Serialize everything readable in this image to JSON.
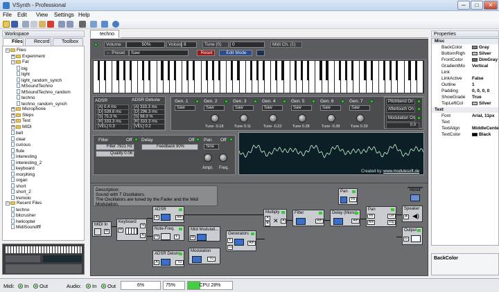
{
  "window": {
    "title": "VSynth - Professional",
    "min": "─",
    "max": "□",
    "close": "✕"
  },
  "menu": [
    "File",
    "Edit",
    "View",
    "Settings",
    "Help"
  ],
  "left_panel": {
    "title": "Workspace",
    "tabs": [
      "Files",
      "Record",
      "Toolbox"
    ],
    "tree": [
      {
        "label": "Files",
        "level": 0,
        "type": "folder",
        "exp": "−"
      },
      {
        "label": "Experiment",
        "level": 1,
        "type": "folder",
        "exp": "+"
      },
      {
        "label": "Fat",
        "level": 1,
        "type": "folder",
        "exp": "−"
      },
      {
        "label": "big",
        "level": 2,
        "type": "doc"
      },
      {
        "label": "light",
        "level": 2,
        "type": "doc"
      },
      {
        "label": "light_random_synch",
        "level": 2,
        "type": "doc"
      },
      {
        "label": "MSoundTechno",
        "level": 2,
        "type": "doc"
      },
      {
        "label": "MSoundTechno_random",
        "level": 2,
        "type": "doc"
      },
      {
        "label": "techno",
        "level": 2,
        "type": "doc"
      },
      {
        "label": "techno_random_synch",
        "level": 2,
        "type": "doc"
      },
      {
        "label": "Microphone",
        "level": 1,
        "type": "folder",
        "exp": "+"
      },
      {
        "label": "Steps",
        "level": 1,
        "type": "folder",
        "exp": "+"
      },
      {
        "label": "Test",
        "level": 1,
        "type": "folder",
        "exp": "+"
      },
      {
        "label": "MIDI",
        "level": 1,
        "type": "folder",
        "exp": "+"
      },
      {
        "label": "bell",
        "level": 1,
        "type": "doc"
      },
      {
        "label": "clear",
        "level": 1,
        "type": "doc"
      },
      {
        "label": "curious",
        "level": 1,
        "type": "doc"
      },
      {
        "label": "flute",
        "level": 1,
        "type": "doc"
      },
      {
        "label": "interesting",
        "level": 1,
        "type": "doc"
      },
      {
        "label": "interesting_2",
        "level": 1,
        "type": "doc"
      },
      {
        "label": "keyboard",
        "level": 1,
        "type": "doc"
      },
      {
        "label": "morphing",
        "level": 1,
        "type": "doc"
      },
      {
        "label": "organ",
        "level": 1,
        "type": "doc"
      },
      {
        "label": "short",
        "level": 1,
        "type": "doc"
      },
      {
        "label": "short_2",
        "level": 1,
        "type": "doc"
      },
      {
        "label": "tremolo",
        "level": 1,
        "type": "doc"
      },
      {
        "label": "Recent Files",
        "level": 0,
        "type": "folder",
        "exp": "−"
      },
      {
        "label": "techno",
        "level": 1,
        "type": "doc"
      },
      {
        "label": "bitcrusher",
        "level": 1,
        "type": "doc"
      },
      {
        "label": "helicopter",
        "level": 1,
        "type": "doc"
      },
      {
        "label": "MidiSoundfff",
        "level": 1,
        "type": "doc"
      }
    ]
  },
  "doc_tab": "techno",
  "controls": {
    "volume_label": "Volume",
    "volume_value": "50%",
    "voices_label": "Voices",
    "voices_value": "8",
    "tune_label": "Tune (0)",
    "tune_value": "0",
    "midi_label": "Midi Ch. (1)",
    "preset_label": "← Preset",
    "preset_value": "Saw",
    "reset": "Reset",
    "edit_mode": "Edit Mode"
  },
  "adsr": {
    "title": "ADSR",
    "rows": [
      "[A] 0.4 ms",
      "[D] 539.8 ms",
      "[S] 75.3 %",
      "[R] 333.3 ms",
      "[VEL] 0.3"
    ]
  },
  "adsr_detune": {
    "title": "ADSR Detune",
    "rows": [
      "[A] 333.3 ms",
      "[D] 296.3 ms",
      "[S] 98.9 %",
      "[R] 333.3 ms",
      "[VEL] 0.2"
    ]
  },
  "generators": [
    {
      "name": "Gen. 1",
      "wave": "Saw",
      "tune": ""
    },
    {
      "name": "Gen. 2",
      "wave": "Saw",
      "tune": "Tune -0.18"
    },
    {
      "name": "Gen. 3",
      "wave": "Saw",
      "tune": "Tune 0.11"
    },
    {
      "name": "Gen. 4",
      "wave": "Saw",
      "tune": "Tune -0.22"
    },
    {
      "name": "Gen. 5",
      "wave": "Saw",
      "tune": "Tune 0.28"
    },
    {
      "name": "Gen. 6",
      "wave": "Saw",
      "tune": "Tune -0.38"
    },
    {
      "name": "Gen. 7",
      "wave": "Saw",
      "tune": "Tune 0.33"
    }
  ],
  "side_toggles": {
    "pitchbend": "Pitchbend On",
    "aftertouch": "Aftertouch On",
    "modulation": "Modulation On",
    "modulation_value": "0.0"
  },
  "filter": {
    "title": "Filter",
    "state": "Off",
    "filter_value": "Filter 7921 Hz",
    "quality": "Quality 0.06"
  },
  "delay": {
    "title": "Delay",
    "state": "Off",
    "feedback": "Feedback 90%"
  },
  "pan": {
    "title": "Pan",
    "state": "Off",
    "wave": "Sine",
    "ampl": "Ampl.",
    "freq": "Freq."
  },
  "scope": {
    "created_by": "Created by:",
    "link": "www.modulesoft.de"
  },
  "description": {
    "title": "Description:",
    "line1": "Sound with 7 Oscillators.",
    "line2": "The Oscillators are tuned by the Fader and the Midi Modulation."
  },
  "patch": {
    "midi_in": "MIDI In",
    "keyboard": "Keyboard",
    "adsr": "ADSR",
    "note_freq": "Note-Freq.",
    "midi_mod": "Midi Modulati...",
    "generators": "Generators",
    "modulation": "Modulation",
    "adsr_detune": "ADSR Detune",
    "multiply": "Multiply",
    "filter": "Filter",
    "delay": "Delay (Mono)",
    "pan_top": "Pan",
    "pan": "Pan",
    "about": "About",
    "speaker": "Speaker",
    "output": "Output",
    "port_a": "A",
    "port_m": "M",
    "port_n": "N",
    "port_f": "F",
    "port_tu": "Tu",
    "port_am": "Am",
    "port_ps": "Ps",
    "port_lef": "Lef",
    "port_rig": "Rig",
    "port_g": "G"
  },
  "properties": {
    "title": "Properties",
    "rows": [
      {
        "k": "Misc",
        "v": "",
        "cat": true
      },
      {
        "k": "BackColor",
        "v": "Gray",
        "sw": "#808080"
      },
      {
        "k": "BottomRigh",
        "v": "Silver",
        "sw": "#c0c0c0"
      },
      {
        "k": "FrontColor",
        "v": "DimGray",
        "sw": "#696969"
      },
      {
        "k": "GradientMo",
        "v": "Vertical"
      },
      {
        "k": "Link",
        "v": ""
      },
      {
        "k": "LinkActive",
        "v": "False"
      },
      {
        "k": "Outline",
        "v": "1"
      },
      {
        "k": "Padding",
        "v": "0, 0, 0, 0"
      },
      {
        "k": "ShowGrade",
        "v": "True"
      },
      {
        "k": "TopLeftCol",
        "v": "Silver",
        "sw": "#c0c0c0"
      },
      {
        "k": "Text",
        "v": "",
        "cat": true
      },
      {
        "k": "Font",
        "v": "Arial, 11px"
      },
      {
        "k": "Text",
        "v": ""
      },
      {
        "k": "TextAlign",
        "v": "MiddleCenter"
      },
      {
        "k": "TextColor",
        "v": "Black",
        "sw": "#000000"
      }
    ],
    "footer": "BackColor"
  },
  "status": {
    "midi_label": "Midi:",
    "midi_in": "In",
    "midi_out": "Out",
    "audio_label": "Audio:",
    "audio_in": "In",
    "audio_out": "Out",
    "vol": "6%",
    "zoom": "75%",
    "cpu": "CPU 28%"
  }
}
